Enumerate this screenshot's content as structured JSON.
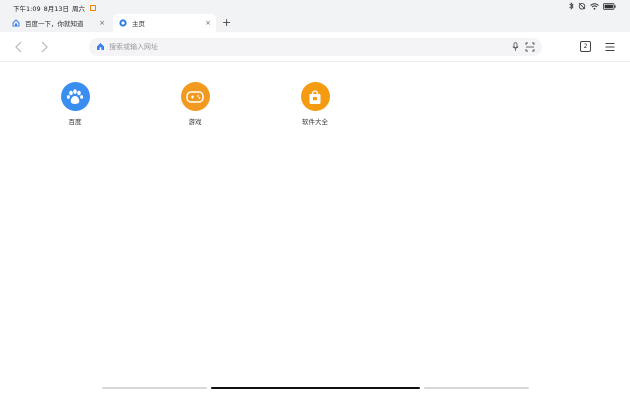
{
  "status": {
    "time": "下午1:09",
    "date": "8月13日",
    "weekday": "周六"
  },
  "tabs": [
    {
      "title": "百度一下，你就知道",
      "close": "×",
      "icon": "baidu-home-icon"
    },
    {
      "title": "主页",
      "close": "×",
      "icon": "browser-logo-icon"
    }
  ],
  "new_tab": "+",
  "omnibox": {
    "placeholder": "搜索或输入网址"
  },
  "tab_count": "2",
  "shortcuts": [
    {
      "label": "百度",
      "icon": "paw-icon",
      "color": "#3a8ef0"
    },
    {
      "label": "游戏",
      "icon": "gamepad-icon",
      "color": "#f29a1f"
    },
    {
      "label": "软件大全",
      "icon": "shopping-bag-icon",
      "color": "#f59b12"
    }
  ]
}
